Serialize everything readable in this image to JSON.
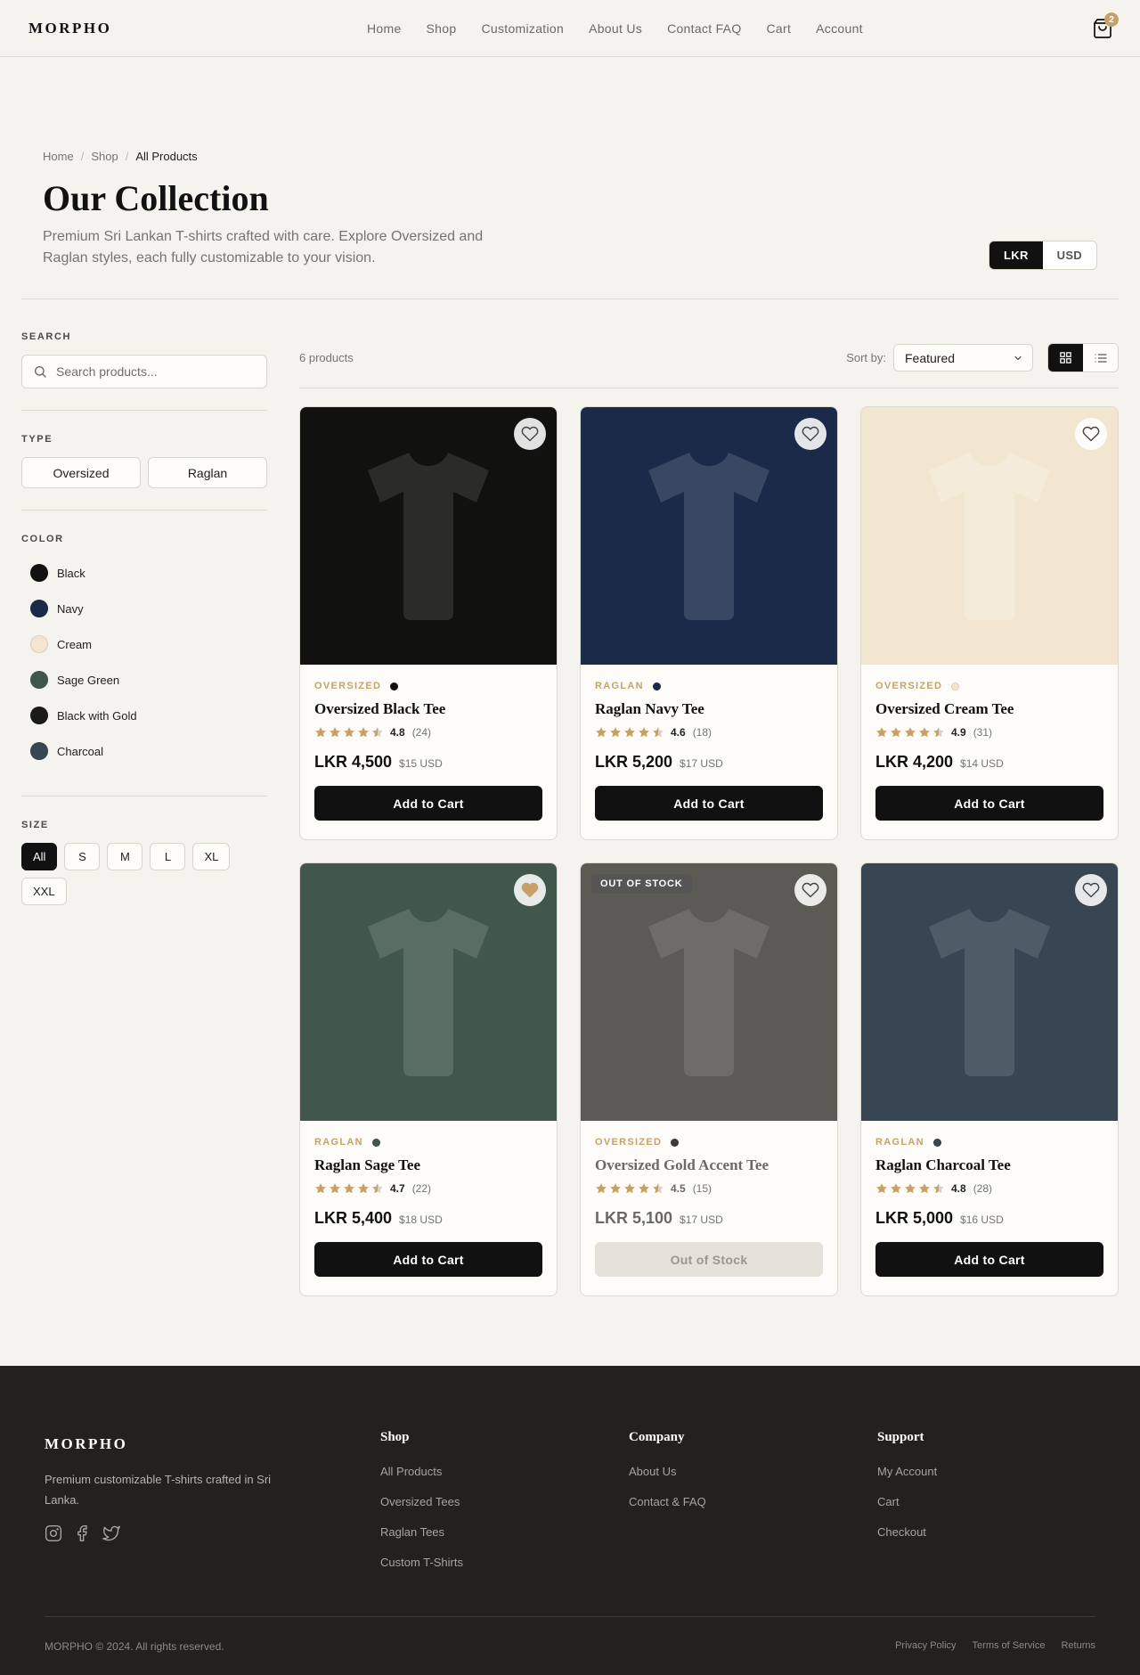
{
  "brand": "MORPHO",
  "nav": [
    "Home",
    "Shop",
    "Customization",
    "About Us",
    "Contact FAQ",
    "Cart",
    "Account"
  ],
  "cart_count": "2",
  "breadcrumb": {
    "home": "Home",
    "shop": "Shop",
    "current": "All Products",
    "sep": "/"
  },
  "hero": {
    "title": "Our Collection",
    "subtitle": "Premium Sri Lankan T-shirts crafted with care. Explore Oversized and Raglan styles, each fully customizable to your vision."
  },
  "currency": {
    "lkr": "LKR",
    "usd": "USD",
    "selected": "LKR"
  },
  "sidebar": {
    "search_heading": "SEARCH",
    "search_placeholder": "Search products...",
    "type_heading": "TYPE",
    "types": [
      "Oversized",
      "Raglan"
    ],
    "color_heading": "COLOR",
    "colors": [
      {
        "name": "Black",
        "hex": "#111111"
      },
      {
        "name": "Navy",
        "hex": "#1c2a4a"
      },
      {
        "name": "Cream",
        "hex": "#f2e6d0"
      },
      {
        "name": "Sage Green",
        "hex": "#42574b"
      },
      {
        "name": "Black with Gold",
        "hex": "#1a1a18"
      },
      {
        "name": "Charcoal",
        "hex": "#384553"
      }
    ],
    "size_heading": "SIZE",
    "sizes": [
      "All",
      "S",
      "M",
      "L",
      "XL",
      "XXL"
    ],
    "selected_size": "All"
  },
  "toolbar": {
    "count": "6 products",
    "sort_label": "Sort by:",
    "sort_value": "Featured",
    "view": "grid"
  },
  "products": [
    {
      "type": "OVERSIZED",
      "name": "Oversized Black Tee",
      "rating": "4.8",
      "rating_value": 4.8,
      "reviews": "(24)",
      "price": "LKR 4,500",
      "usd": "$15 USD",
      "button": "Add to Cart",
      "bg": "#111110",
      "shirt": "#2b2b29",
      "dot": "#111111",
      "favorited": false,
      "out_of_stock": false
    },
    {
      "type": "RAGLAN",
      "name": "Raglan Navy Tee",
      "rating": "4.6",
      "rating_value": 4.6,
      "reviews": "(18)",
      "price": "LKR 5,200",
      "usd": "$17 USD",
      "button": "Add to Cart",
      "bg": "#1c2a4a",
      "shirt": "#3a4763",
      "dot": "#1c2a4a",
      "favorited": false,
      "out_of_stock": false
    },
    {
      "type": "OVERSIZED",
      "name": "Oversized Cream Tee",
      "rating": "4.9",
      "rating_value": 4.9,
      "reviews": "(31)",
      "price": "LKR 4,200",
      "usd": "$14 USD",
      "button": "Add to Cart",
      "bg": "#f2e6d0",
      "shirt": "#f4ebdb",
      "dot": "#f2e6d0",
      "favorited": false,
      "out_of_stock": false
    },
    {
      "type": "RAGLAN",
      "name": "Raglan Sage Tee",
      "rating": "4.7",
      "rating_value": 4.7,
      "reviews": "(22)",
      "price": "LKR 5,400",
      "usd": "$18 USD",
      "button": "Add to Cart",
      "bg": "#42574b",
      "shirt": "#5a6d63",
      "dot": "#42574b",
      "favorited": true,
      "out_of_stock": false
    },
    {
      "type": "OVERSIZED",
      "name": "Oversized Gold Accent Tee",
      "rating": "4.5",
      "rating_value": 4.5,
      "reviews": "(15)",
      "price": "LKR 5,100",
      "usd": "$17 USD",
      "button": "Out of Stock",
      "badge": "OUT OF STOCK",
      "bg": "#5c5a55",
      "shirt": "#6e6c67",
      "dot": "#3d3c39",
      "favorited": false,
      "out_of_stock": true
    },
    {
      "type": "RAGLAN",
      "name": "Raglan Charcoal Tee",
      "rating": "4.8",
      "rating_value": 4.8,
      "reviews": "(28)",
      "price": "LKR 5,000",
      "usd": "$16 USD",
      "button": "Add to Cart",
      "bg": "#384553",
      "shirt": "#4f5b67",
      "dot": "#384553",
      "favorited": false,
      "out_of_stock": false
    }
  ],
  "footer": {
    "brand": "MORPHO",
    "description": "Premium customizable T-shirts crafted in Sri Lanka.",
    "columns": [
      {
        "title": "Shop",
        "links": [
          "All Products",
          "Oversized Tees",
          "Raglan Tees",
          "Custom T-Shirts"
        ]
      },
      {
        "title": "Company",
        "links": [
          "About Us",
          "Contact & FAQ"
        ]
      },
      {
        "title": "Support",
        "links": [
          "My Account",
          "Cart",
          "Checkout"
        ]
      }
    ],
    "copyright": "MORPHO © 2024. All rights reserved.",
    "legal": [
      "Privacy Policy",
      "Terms of Service",
      "Returns"
    ]
  },
  "colors": {
    "accent": "#c6a26a",
    "dark": "#111111",
    "background": "#f5f3ee",
    "footer": "#22211e"
  }
}
